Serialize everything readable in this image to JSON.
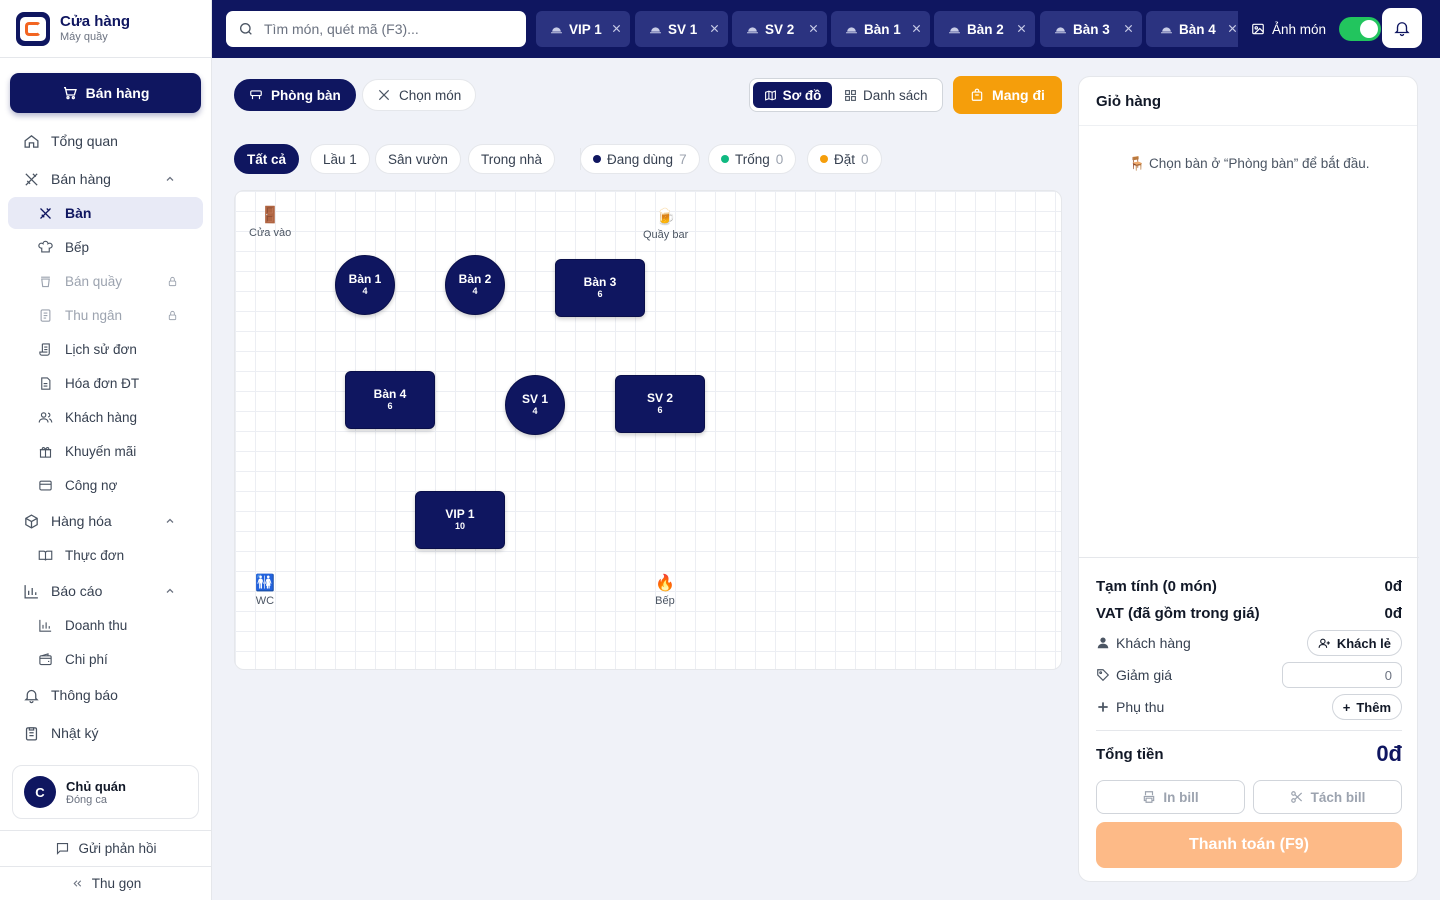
{
  "brand": {
    "name": "Cửa hàng",
    "sub": "Máy quầy"
  },
  "sidebar": {
    "primary_button": "Bán hàng",
    "items": [
      {
        "label": "Tổng quan"
      },
      {
        "label": "Bán hàng"
      },
      {
        "label": "Bàn"
      },
      {
        "label": "Bếp"
      },
      {
        "label": "Bán quầy"
      },
      {
        "label": "Thu ngân"
      },
      {
        "label": "Lịch sử đơn"
      },
      {
        "label": "Hóa đơn ĐT"
      },
      {
        "label": "Khách hàng"
      },
      {
        "label": "Khuyến mãi"
      },
      {
        "label": "Công nợ"
      },
      {
        "label": "Hàng hóa"
      },
      {
        "label": "Thực đơn"
      },
      {
        "label": "Báo cáo"
      },
      {
        "label": "Doanh thu"
      },
      {
        "label": "Chi phí"
      },
      {
        "label": "Thông báo"
      },
      {
        "label": "Nhật ký"
      }
    ],
    "user": {
      "initial": "C",
      "name": "Chủ quán",
      "role": "Đóng ca"
    },
    "feedback": "Gửi phản hồi",
    "collapse": "Thu gọn"
  },
  "topbar": {
    "search_placeholder": "Tìm món, quét mã (F3)...",
    "tabs": [
      "VIP 1",
      "SV 1",
      "SV 2",
      "Bàn 1",
      "Bàn 2",
      "Bàn 3",
      "Bàn 4"
    ],
    "photo_toggle": "Ảnh món"
  },
  "main": {
    "mode_tabs": [
      "Phòng bàn",
      "Chọn món"
    ],
    "view_toggle": [
      "Sơ đồ",
      "Danh sách"
    ],
    "takeaway": "Mang đi",
    "area_filters": [
      "Tất cả",
      "Lầu 1",
      "Sân vườn",
      "Trong nhà"
    ],
    "status_filters": [
      {
        "label": "Đang dùng",
        "count": "7",
        "color": "#0f1660"
      },
      {
        "label": "Trống",
        "count": "0",
        "color": "#10b981"
      },
      {
        "label": "Đặt",
        "count": "0",
        "color": "#f59e0b"
      }
    ],
    "landmarks": [
      {
        "label": "Cửa vào",
        "icon": "door-icon"
      },
      {
        "label": "Quầy bar",
        "icon": "beer-icon"
      },
      {
        "label": "WC",
        "icon": "restroom-icon"
      },
      {
        "label": "Bếp",
        "icon": "fire-icon"
      }
    ],
    "tables": [
      {
        "name": "Bàn 1",
        "seats": "4"
      },
      {
        "name": "Bàn 2",
        "seats": "4"
      },
      {
        "name": "Bàn 3",
        "seats": "6"
      },
      {
        "name": "Bàn 4",
        "seats": "6"
      },
      {
        "name": "SV 1",
        "seats": "4"
      },
      {
        "name": "SV 2",
        "seats": "6"
      },
      {
        "name": "VIP 1",
        "seats": "10"
      }
    ]
  },
  "cart": {
    "title": "Giỏ hàng",
    "empty_msg": "Chọn bàn ở “Phòng bàn” để bắt đầu.",
    "subtotal_label": "Tạm tính (0 món)",
    "subtotal_value": "0đ",
    "vat_label": "VAT (đã gồm trong giá)",
    "vat_value": "0đ",
    "customer_label": "Khách hàng",
    "customer_button": "Khách lẻ",
    "discount_label": "Giảm giá",
    "discount_value": "0",
    "surcharge_label": "Phụ thu",
    "surcharge_button": "Thêm",
    "total_label": "Tổng tiền",
    "total_value": "0đ",
    "print_bill": "In bill",
    "split_bill": "Tách bill",
    "pay_button": "Thanh toán (F9)"
  }
}
